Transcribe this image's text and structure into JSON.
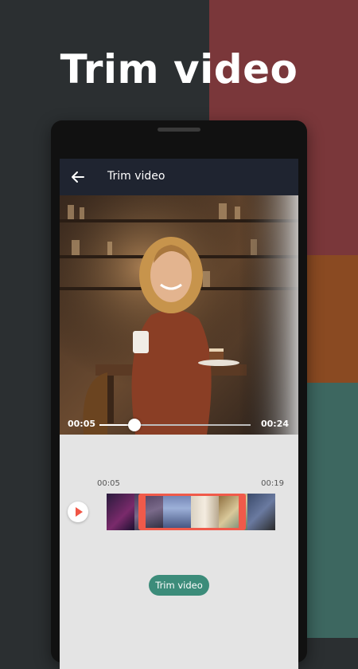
{
  "headline": "Trim video",
  "appbar": {
    "title": "Trim video",
    "back_icon": "arrow-left-icon"
  },
  "player": {
    "current_time": "00:05",
    "duration": "00:24",
    "progress": 0.23
  },
  "trimmer": {
    "range_start": "00:05",
    "range_end": "00:19",
    "play_icon": "play-icon",
    "frames": [
      "frame-1",
      "frame-2",
      "frame-3",
      "frame-4",
      "frame-5",
      "frame-6"
    ],
    "trim_button_label": "Trim video"
  },
  "colors": {
    "accent": "#f05a4a",
    "button": "#3c8c7a",
    "appbar": "#1f2430",
    "bg_dark": "#2b2f31",
    "bg_red": "#7a373a",
    "bg_orange": "#8a4a22",
    "bg_teal": "#3d6760"
  }
}
